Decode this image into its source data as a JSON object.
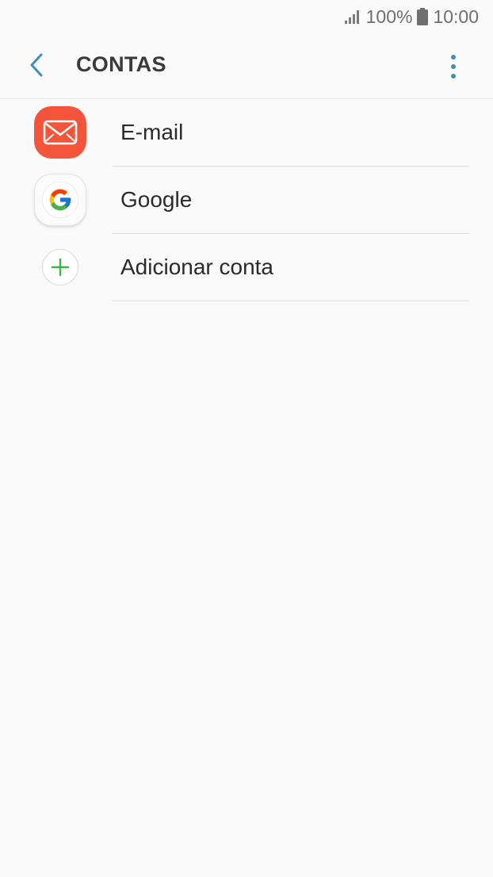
{
  "status_bar": {
    "battery_percent": "100%",
    "time": "10:00"
  },
  "app_bar": {
    "title": "CONTAS"
  },
  "accounts": [
    {
      "label": "E-mail",
      "icon": "email-icon"
    },
    {
      "label": "Google",
      "icon": "google-icon"
    },
    {
      "label": "Adicionar conta",
      "icon": "add-icon"
    }
  ],
  "colors": {
    "accent": "#3d8fbf",
    "email_icon_bg": "#f4553a",
    "add_icon": "#3bb54a",
    "background": "#fafafa"
  }
}
